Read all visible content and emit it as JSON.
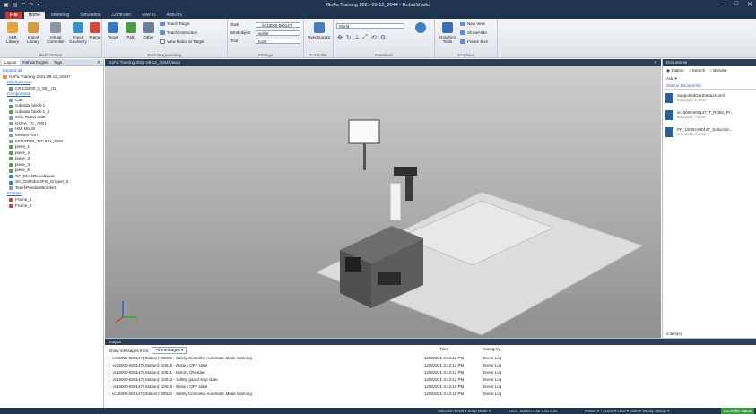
{
  "titlebar": {
    "title": "GoFa Training 2021-09-12_2044 - RobotStudio",
    "minimize": "–",
    "maximize": "□",
    "close": "✕"
  },
  "menu_tabs": [
    "File",
    "Home",
    "Modeling",
    "Simulation",
    "Controller",
    "RAPID",
    "Add-Ins"
  ],
  "ribbon": {
    "build_station": {
      "label": "Build Station",
      "buttons": [
        "ABB Library",
        "Import Library",
        "Virtual Controller",
        "Import Geometry",
        "Frame"
      ]
    },
    "path_programming": {
      "label": "Path Programming",
      "buttons": [
        "Target",
        "Path",
        "Other"
      ],
      "small": [
        "Teach Target",
        "Teach Instruction",
        "View Robot at Target"
      ]
    },
    "settings": {
      "label": "Settings",
      "task_label": "Task",
      "task_value": "...(vc15000-500147)",
      "wobj_label": "Workobject",
      "wobj_value": "wobj0",
      "tool_label": "Tool",
      "tool_value": "tool0"
    },
    "controller": {
      "label": "Controller",
      "button": "Synchronize"
    },
    "freehand": {
      "label": "Freehand",
      "frame_value": "World"
    },
    "graphics": {
      "label": "Graphics",
      "button": "Graphics Tools",
      "small": [
        "New View",
        "Show/Hide",
        "Frame Size"
      ]
    }
  },
  "left_panel": {
    "tabs": [
      "Layout",
      "Paths&Targets",
      "Tags"
    ],
    "expand_all": "Expand all",
    "items": [
      {
        "text": "GoFa Training 2021-09-12_2044*",
        "type": "station"
      },
      {
        "text": "Mechanisms",
        "type": "header"
      },
      {
        "text": "CRB15000_5_95__01",
        "type": "robot"
      },
      {
        "text": "Components",
        "type": "header"
      },
      {
        "text": "Cart",
        "type": "part"
      },
      {
        "text": "cuboidal block-1",
        "type": "part"
      },
      {
        "text": "cuboidal block-1_2",
        "type": "part"
      },
      {
        "text": "eGC Robot Side",
        "type": "part"
      },
      {
        "text": "GOFA_TC_A001",
        "type": "part"
      },
      {
        "text": "HMI Mount",
        "type": "part"
      },
      {
        "text": "Monitor Arm",
        "type": "part"
      },
      {
        "text": "MONITOR_TOUCH_ASM",
        "type": "part"
      },
      {
        "text": "piece_1",
        "type": "part"
      },
      {
        "text": "piece_2",
        "type": "part"
      },
      {
        "text": "piece_3",
        "type": "part"
      },
      {
        "text": "piece_4",
        "type": "part"
      },
      {
        "text": "piece_5",
        "type": "part"
      },
      {
        "text": "SC_BlockPieceReset",
        "type": "smart"
      },
      {
        "text": "SC_OnRobot2FG_Gripper_3",
        "type": "smart"
      },
      {
        "text": "TeachPendantBracket",
        "type": "part"
      },
      {
        "text": "Frames",
        "type": "header"
      },
      {
        "text": "Frame_1",
        "type": "frame"
      },
      {
        "text": "Frame_2",
        "type": "frame"
      }
    ]
  },
  "viewport": {
    "title": "GoFa Training 2021-09-12_2044:View1"
  },
  "right_panel": {
    "title": "Documents",
    "radio": [
      "Station",
      "Search",
      "Browse"
    ],
    "add": "Add",
    "section": "Station Documents",
    "docs": [
      {
        "name": "SupportedGenDataList.xml",
        "meta": "9/11/2021, 6.1 KB"
      },
      {
        "name": "vc15000-500147_T_ROB1_Pr...",
        "meta": "9/11/2021, 7.6 KB"
      },
      {
        "name": "PC_15000-500147_Subscript...",
        "meta": "9/12/2021, 2.6 KB"
      }
    ],
    "footer": "3 item(s)"
  },
  "output": {
    "title": "Output",
    "filter_label": "Show messages from:",
    "filter_value": "All messages",
    "col_time": "Time",
    "col_category": "Category",
    "rows": [
      {
        "icon": "warning",
        "msg": "vc15000-500147 (Station): 50526 - Safety Controller Automatic Mode Warning",
        "time": "12/3/2021 3:43:12 PM",
        "cat": "Event Log"
      },
      {
        "icon": "info",
        "msg": "vc15000-500147 (Station): 10010 - Motors OFF state",
        "time": "12/3/2021 3:43:12 PM",
        "cat": "Event Log"
      },
      {
        "icon": "info",
        "msg": "vc15000-500147 (Station): 10011 - Motors ON state",
        "time": "12/3/2021 3:43:12 PM",
        "cat": "Event Log"
      },
      {
        "icon": "info",
        "msg": "vc15000-500147 (Station): 10012 - Safety guard stop state",
        "time": "12/3/2021 3:43:12 PM",
        "cat": "Event Log"
      },
      {
        "icon": "info",
        "msg": "vc15000-500147 (Station): 10010 - Motors OFF state",
        "time": "12/3/2021 3:43:15 PM",
        "cat": "Event Log"
      },
      {
        "icon": "warning",
        "msg": "vc15000-500147 (Station): 50526 - Safety Controller Automatic Mode Warning",
        "time": "12/3/2021 3:43:15 PM",
        "cat": "Event Log"
      }
    ]
  },
  "statusbar": {
    "selection": "Selection Level ▾ Snap Mode ▾",
    "ucs": "UCS: Station  0.00  0.00  0.00",
    "controller": "MoveL ▾ * v1000 ▾ z100 ▾ tool0 ▾ \\WObj:=wobj0 ▾",
    "status": "Controller status"
  },
  "colors": {
    "title_bg": "#20344f",
    "file_tab": "#c9372c",
    "status_green": "#3c9a3c"
  }
}
